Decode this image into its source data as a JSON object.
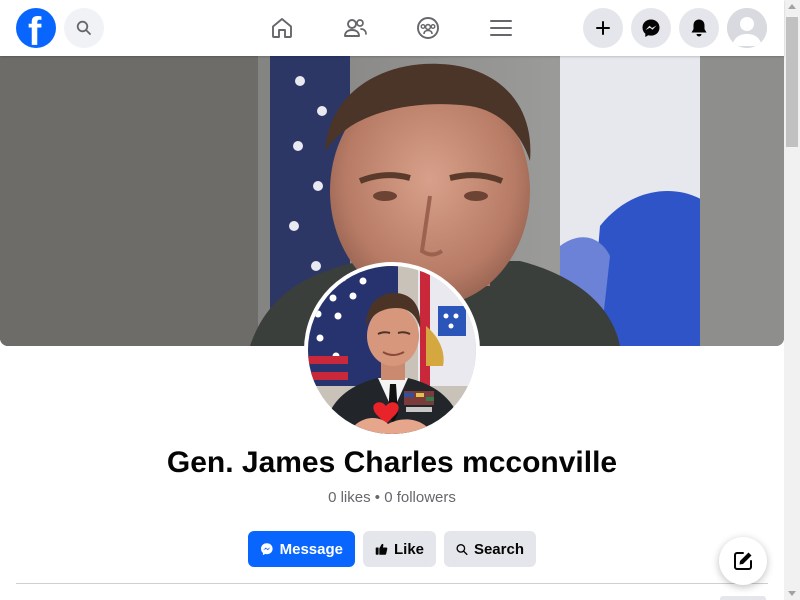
{
  "topbar": {
    "logo_letter": "f",
    "icons": {
      "logo": "facebook-logo-icon",
      "search": "search-icon",
      "home": "home-icon",
      "friends": "friends-icon",
      "groups": "groups-icon",
      "menu": "hamburger-menu-icon",
      "create": "plus-icon",
      "messenger": "messenger-icon",
      "notifications": "bell-icon",
      "account": "avatar-icon"
    }
  },
  "profile": {
    "name": "Gen. James Charles mcconville",
    "stats": "0 likes • 0 followers"
  },
  "actions": {
    "message_label": "Message",
    "like_label": "Like",
    "search_label": "Search"
  },
  "colors": {
    "brand": "#0866ff",
    "secondary_button": "#e4e6eb",
    "text_primary": "#050505",
    "text_secondary": "#65676b"
  }
}
